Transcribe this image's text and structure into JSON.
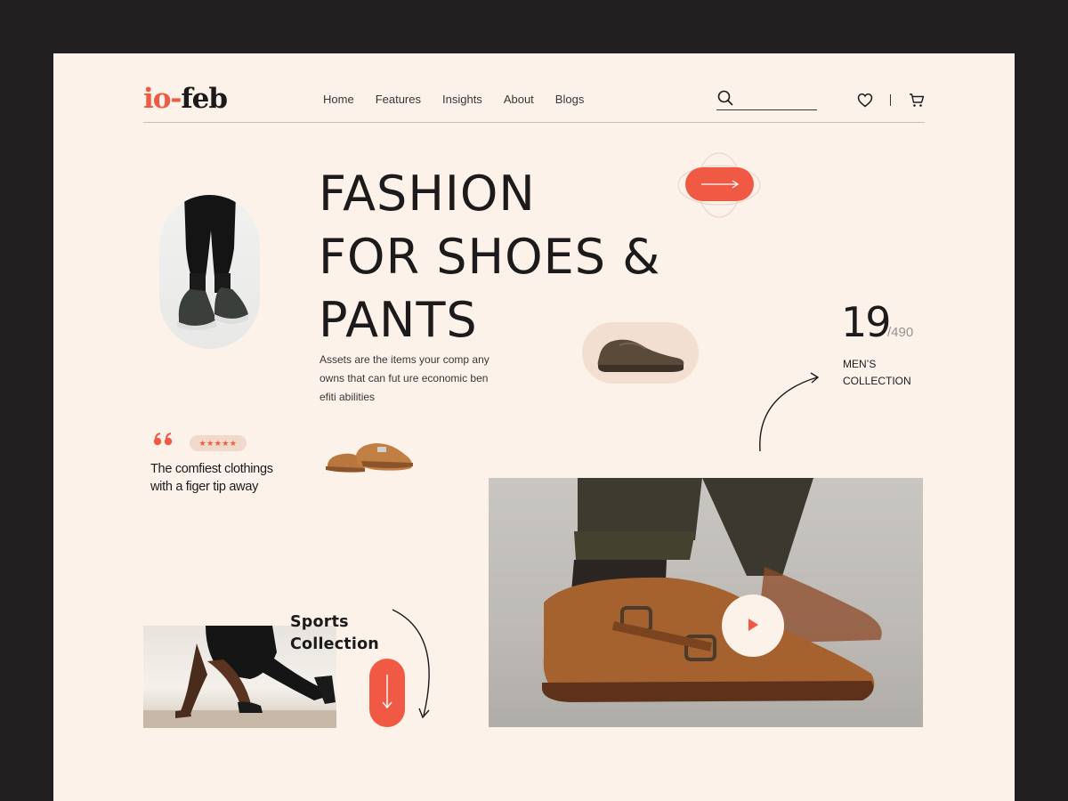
{
  "header": {
    "logo_part1": "io",
    "logo_dash": "-",
    "logo_part2": "feb",
    "nav": [
      "Home",
      "Features",
      "Insights",
      "About",
      "Blogs"
    ],
    "search_placeholder": ""
  },
  "hero": {
    "title_lines": [
      "FASHION",
      "FOR SHOES &",
      "PANTS"
    ],
    "description": "Assets are the items your comp any owns that can  fut ure economic ben efiti abilities"
  },
  "collection": {
    "count": "19",
    "total": "/490",
    "label_line1": "MEN’S",
    "label_line2": "COLLECTION"
  },
  "testimonial": {
    "rating": 5,
    "text": "The comfiest clothings with a figer tip away"
  },
  "sports": {
    "title_line1": "Sports",
    "title_line2": "Collection"
  },
  "icons": {
    "search": "search-icon",
    "heart": "heart-icon",
    "cart": "cart-icon",
    "arrow_right": "arrow-right-icon",
    "arrow_down": "arrow-down-icon",
    "play": "play-icon",
    "quote": "quote-icon",
    "star": "star-icon"
  },
  "colors": {
    "accent": "#f05a45",
    "background": "#fdf2ea",
    "frame": "#211f1f",
    "text": "#1c1a1a"
  }
}
